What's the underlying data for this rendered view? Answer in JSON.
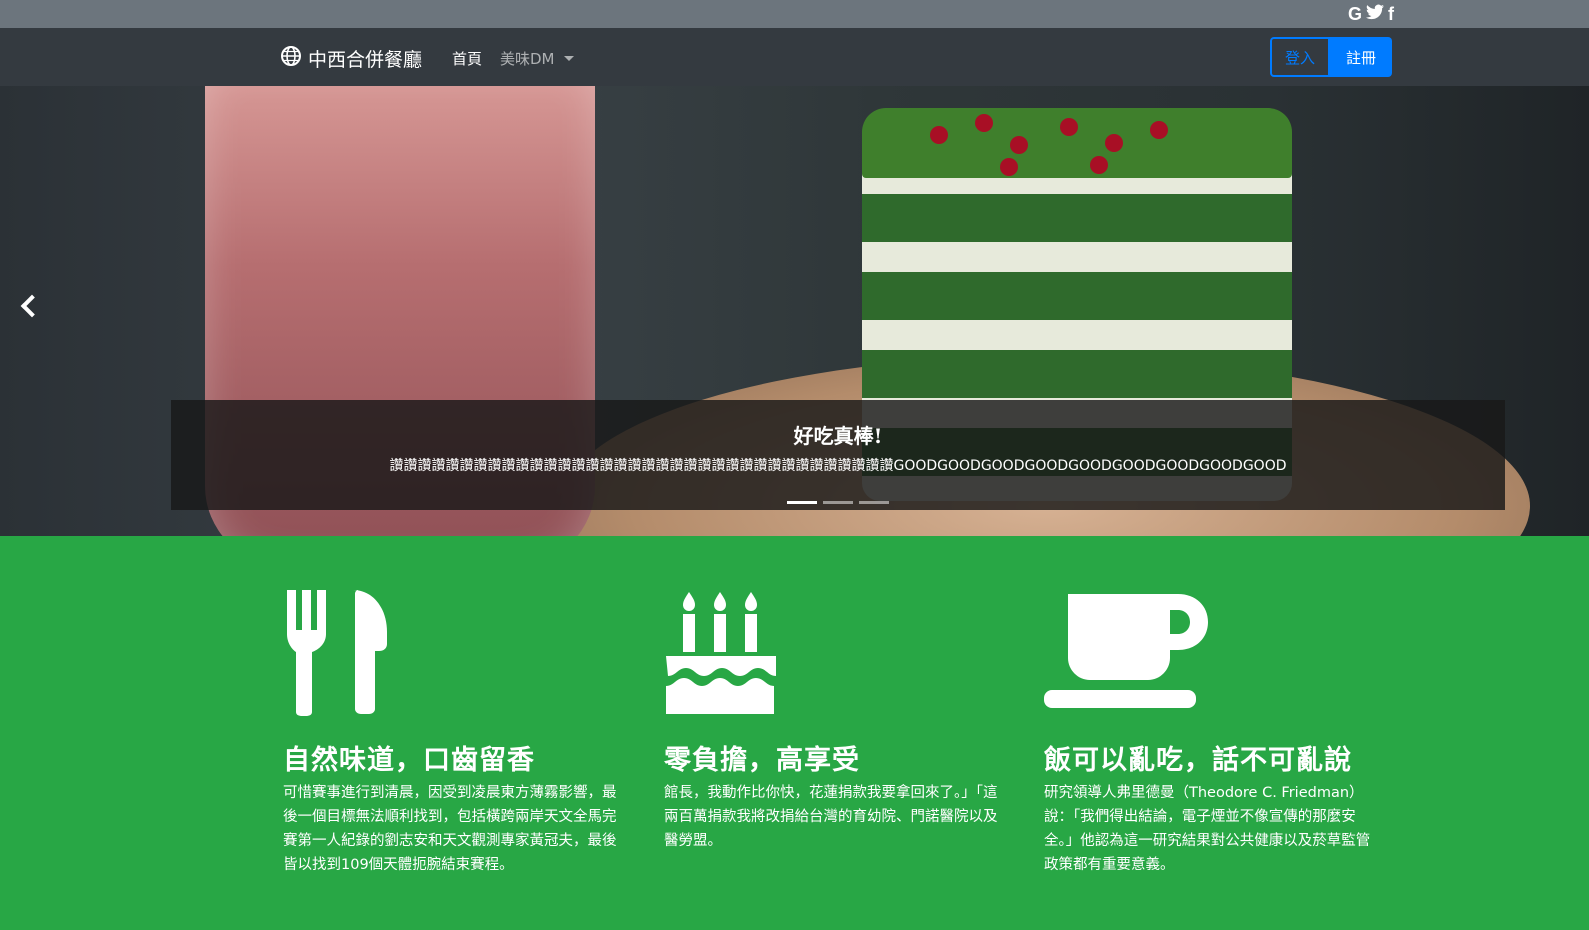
{
  "social": {
    "icons": [
      "google-icon",
      "twitter-icon",
      "facebook-icon"
    ],
    "google": "G",
    "twitter": "t",
    "facebook": "f"
  },
  "navbar": {
    "brand": "中西合併餐廳",
    "home": "首頁",
    "dm": "美味DM",
    "login": "登入",
    "register": "註冊"
  },
  "carousel": {
    "caption_title": "好吃真棒!",
    "caption_text": "讚讚讚讚讚讚讚讚讚讚讚讚讚讚讚讚讚讚讚讚讚讚讚讚讚讚讚讚讚讚讚讚讚讚讚讚GOODGOODGOODGOODGOODGOODGOODGOODGOOD",
    "slide_count": 3,
    "active_slide": 1
  },
  "features": [
    {
      "icon": "utensils-icon",
      "title": "自然味道，口齒留香",
      "text": "可惜賽事進行到清晨，因受到凌晨東方薄霧影響，最後一個目標無法順利找到，包括橫跨兩岸天文全馬完賽第一人紀錄的劉志安和天文觀測專家黃冠夫，最後皆以找到109個天體扼腕結束賽程。"
    },
    {
      "icon": "birthday-cake-icon",
      "title": "零負擔，高享受",
      "text": "館長，我動作比你快，花蓮捐款我要拿回來了。」「這兩百萬捐款我將改捐給台灣的育幼院、門諾醫院以及醫勞盟。"
    },
    {
      "icon": "coffee-cup-icon",
      "title": "飯可以亂吃，話不可亂說",
      "text": "研究領導人弗里德曼（Theodore C. Friedman）說：「我們得出結論，電子煙並不像宣傳的那麼安全。」他認為這一研究結果對公共健康以及菸草監管政策都有重要意義。"
    }
  ],
  "colors": {
    "topbar": "#6c757d",
    "navbar": "#343a40",
    "primary": "#007bff",
    "feature_bg": "#28a745"
  }
}
